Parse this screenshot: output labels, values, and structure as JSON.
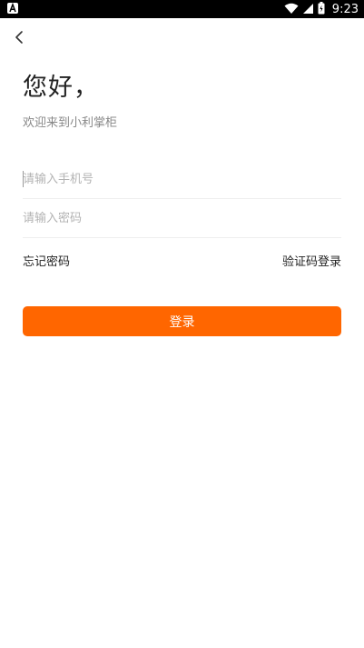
{
  "status_bar": {
    "time": "9:23",
    "icons": [
      "notification-a-icon",
      "wifi-icon",
      "signal-icon",
      "battery-icon"
    ]
  },
  "header": {
    "back_icon": "chevron-left-icon"
  },
  "main": {
    "greeting": "您好，",
    "welcome": "欢迎来到小利掌柜"
  },
  "form": {
    "phone_placeholder": "请输入手机号",
    "phone_value": "",
    "password_placeholder": "请输入密码",
    "password_value": ""
  },
  "links": {
    "forgot_password": "忘记密码",
    "code_login": "验证码登录"
  },
  "actions": {
    "login": "登录"
  },
  "colors": {
    "accent": "#ff6600",
    "status_bar": "#000000"
  }
}
